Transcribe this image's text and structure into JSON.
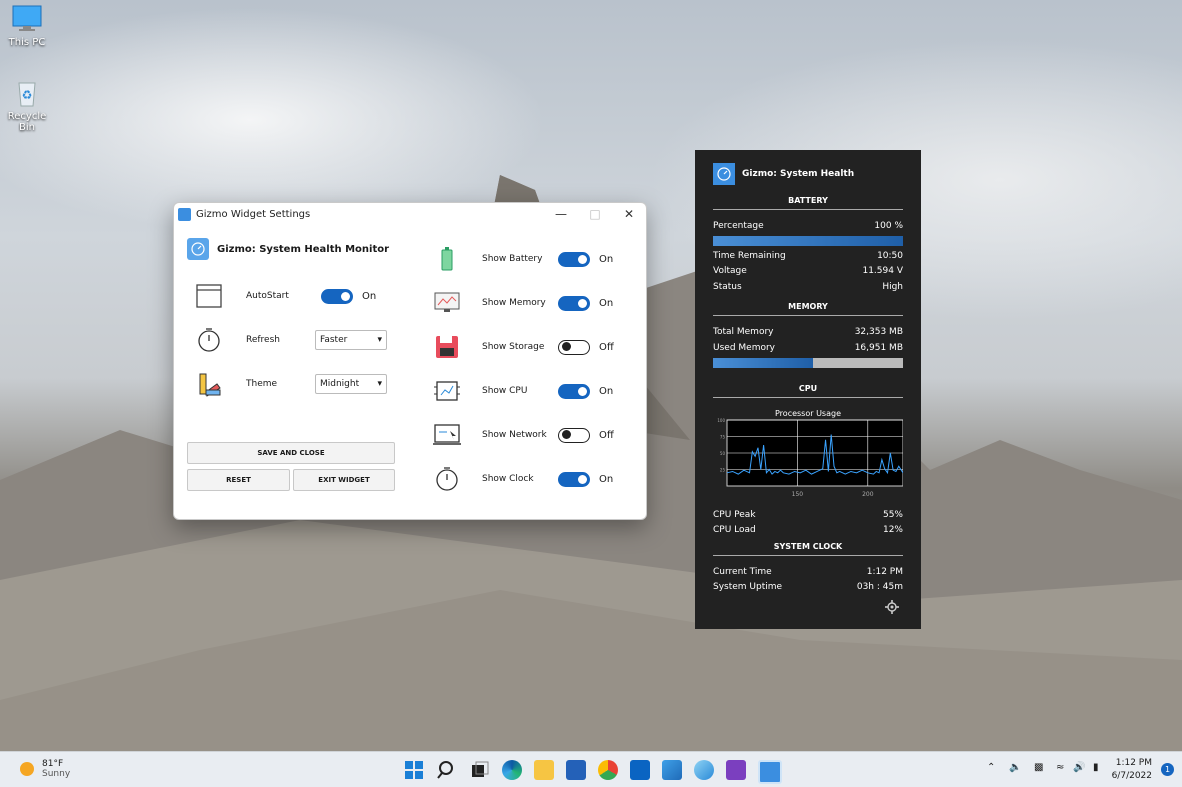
{
  "desktop": {
    "icons": [
      {
        "label": "This PC",
        "icon": "monitor-icon"
      },
      {
        "label": "Recycle Bin",
        "icon": "recycle-bin-icon"
      }
    ]
  },
  "settings": {
    "window_title": "Gizmo Widget Settings",
    "header": "Gizmo: System Health Monitor",
    "autostart": {
      "label": "AutoStart",
      "state": "On"
    },
    "refresh": {
      "label": "Refresh",
      "value": "Faster"
    },
    "theme": {
      "label": "Theme",
      "value": "Midnight"
    },
    "buttons": {
      "save": "SAVE AND CLOSE",
      "reset": "RESET",
      "exit": "EXIT WIDGET"
    },
    "toggles": [
      {
        "label": "Show Battery",
        "state": "On",
        "icon": "battery-icon"
      },
      {
        "label": "Show Memory",
        "state": "On",
        "icon": "memory-chart-icon"
      },
      {
        "label": "Show Storage",
        "state": "Off",
        "icon": "floppy-disk-icon"
      },
      {
        "label": "Show CPU",
        "state": "On",
        "icon": "cpu-icon"
      },
      {
        "label": "Show Network",
        "state": "Off",
        "icon": "network-icon"
      },
      {
        "label": "Show Clock",
        "state": "On",
        "icon": "stopwatch-icon"
      }
    ]
  },
  "widget": {
    "title": "Gizmo: System Health",
    "battery": {
      "section": "BATTERY",
      "percentage_label": "Percentage",
      "percentage": "100 %",
      "percentage_value": 1.0,
      "time_label": "Time Remaining",
      "time": "10:50",
      "voltage_label": "Voltage",
      "voltage": "11.594 V",
      "status_label": "Status",
      "status": "High"
    },
    "memory": {
      "section": "MEMORY",
      "total_label": "Total Memory",
      "total": "32,353 MB",
      "used_label": "Used Memory",
      "used": "16,951 MB",
      "used_fraction": 0.524
    },
    "cpu": {
      "section": "CPU",
      "chart_title": "Processor Usage",
      "peak_label": "CPU Peak",
      "peak": "55%",
      "load_label": "CPU Load",
      "load": "12%"
    },
    "clock": {
      "section": "SYSTEM CLOCK",
      "time_label": "Current Time",
      "time": "1:12 PM",
      "uptime_label": "System Uptime",
      "uptime": "03h : 45m"
    }
  },
  "chart_data": {
    "type": "line",
    "title": "Processor Usage",
    "xlabel": "",
    "ylabel": "",
    "xticks": [
      "150",
      "200"
    ],
    "yticks": [
      "100",
      "75",
      "50",
      "25"
    ],
    "ylim": [
      0,
      100
    ],
    "xlim": [
      100,
      225
    ],
    "series": [
      {
        "x": [
          100,
          104,
          108,
          112,
          116,
          118,
          120,
          122,
          124,
          126,
          128,
          130,
          132,
          134,
          136,
          138,
          140,
          144,
          148,
          152,
          156,
          160,
          164,
          168,
          170,
          172,
          174,
          176,
          178,
          180,
          184,
          188,
          192,
          196,
          200,
          204,
          206,
          208,
          210,
          212,
          214,
          216,
          218,
          220,
          222,
          225
        ],
        "y": [
          20,
          22,
          18,
          24,
          20,
          52,
          45,
          58,
          25,
          62,
          20,
          25,
          18,
          22,
          20,
          24,
          20,
          18,
          22,
          20,
          24,
          18,
          22,
          26,
          70,
          22,
          78,
          30,
          20,
          22,
          18,
          22,
          20,
          24,
          20,
          18,
          22,
          20,
          40,
          26,
          20,
          50,
          24,
          22,
          30,
          20
        ]
      }
    ]
  },
  "taskbar": {
    "weather": {
      "temp": "81°F",
      "condition": "Sunny"
    },
    "apps": [
      "windows-start-icon",
      "search-icon",
      "task-view-icon",
      "edge-icon",
      "file-explorer-icon",
      "store-icon",
      "chrome-icon",
      "outlook-icon",
      "photos-icon",
      "browser-icon",
      "visual-studio-icon",
      "gizmo-icon"
    ],
    "time": "1:12 PM",
    "date": "6/7/2022",
    "notifications": "1",
    "colors": {
      "accent": "#1565c0",
      "widget_bg": "#222222"
    }
  }
}
